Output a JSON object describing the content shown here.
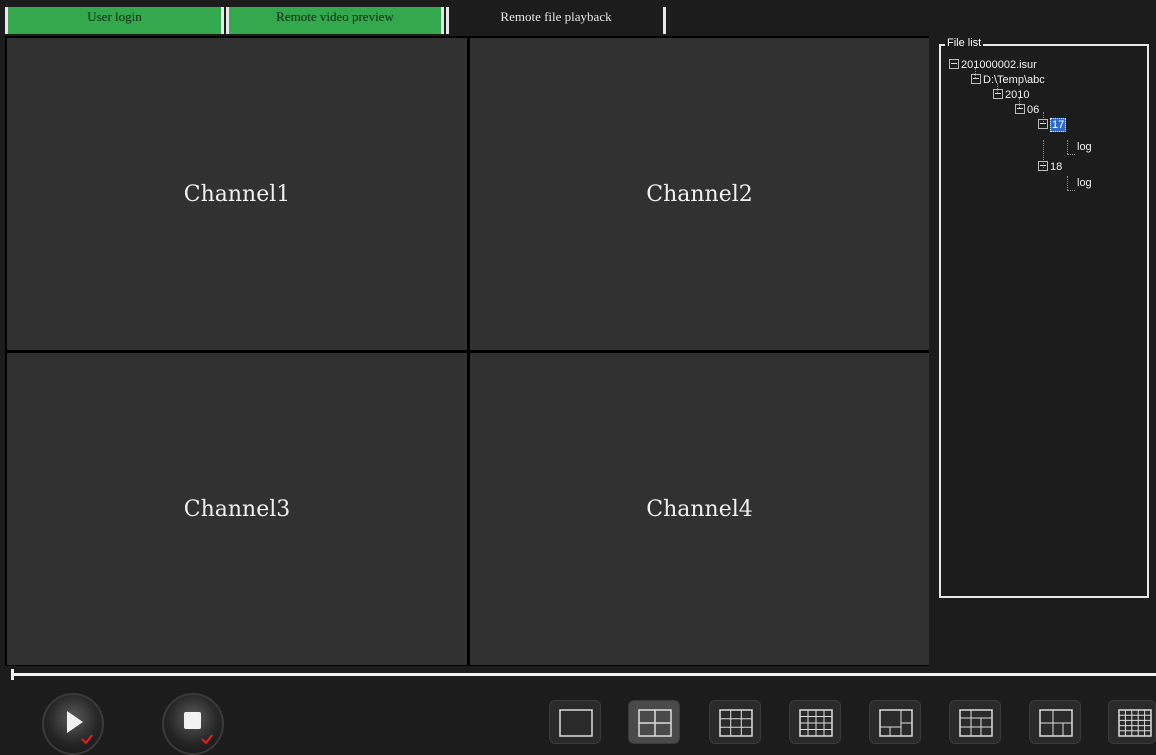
{
  "tabs": [
    {
      "label": "User login"
    },
    {
      "label": "Remote video preview"
    },
    {
      "label": "Remote file playback"
    }
  ],
  "channels": [
    {
      "label": "Channel1"
    },
    {
      "label": "Channel2"
    },
    {
      "label": "Channel3"
    },
    {
      "label": "Channel4"
    }
  ],
  "file_list": {
    "legend": "File list",
    "tree": {
      "root": "201000002.isur",
      "dir": "D:\\Temp\\abc",
      "year": "2010",
      "month": "06",
      "day_selected": "17",
      "day_selected_child": "log",
      "day2": "18",
      "day2_child": "log"
    }
  },
  "controls": {
    "play_icon": "play-icon",
    "stop_icon": "stop-icon",
    "playback_progress": 0
  },
  "colors": {
    "tab_active": "#33a84d",
    "channel_bg": "#313131",
    "selection": "#316ac5"
  }
}
